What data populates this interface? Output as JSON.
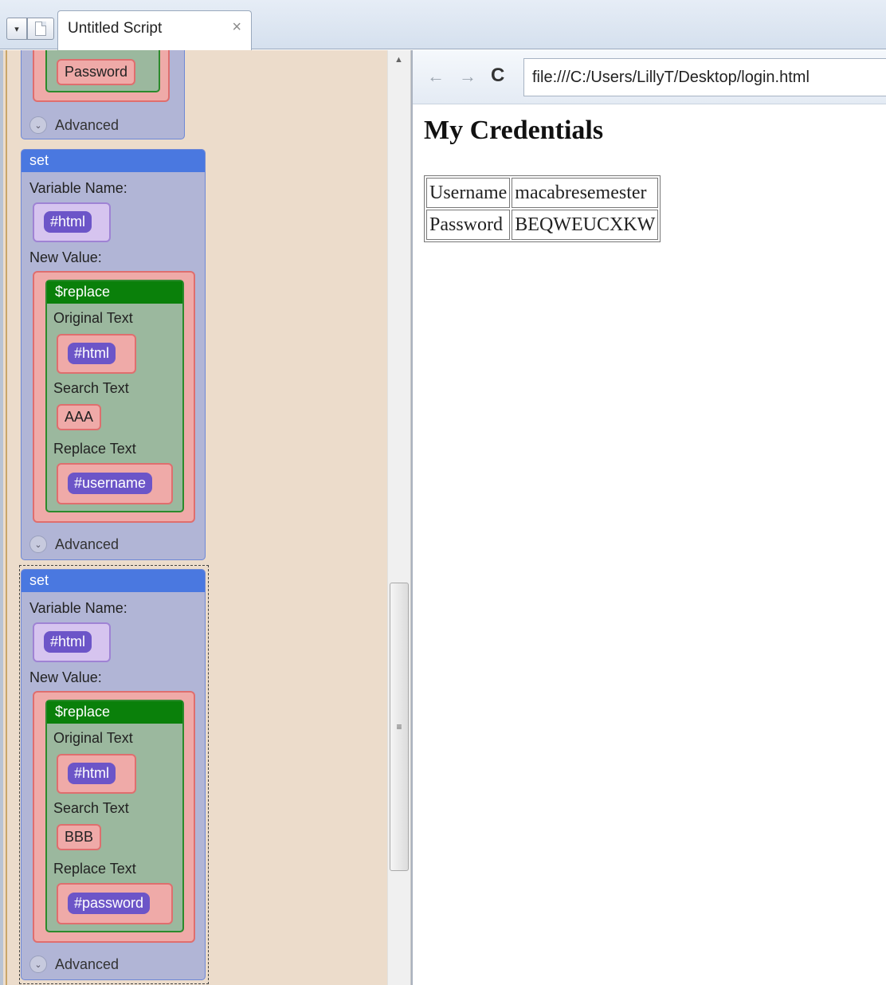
{
  "window": {
    "tab_title": "Untitled Script",
    "tab_close_glyph": "×",
    "menu_glyph": "▾"
  },
  "script_panel": {
    "top_fragment": {
      "chip": "Password",
      "advanced": "Advanced"
    },
    "set_blocks": [
      {
        "header": "set",
        "variable_label": "Variable Name:",
        "variable": "#html",
        "new_value_label": "New Value:",
        "replace": {
          "header": "$replace",
          "original_label": "Original Text",
          "original_var": "#html",
          "search_label": "Search Text",
          "search_value": "AAA",
          "replace_label": "Replace Text",
          "replace_var": "#username"
        },
        "advanced": "Advanced"
      },
      {
        "header": "set",
        "variable_label": "Variable Name:",
        "variable": "#html",
        "new_value_label": "New Value:",
        "replace": {
          "header": "$replace",
          "original_label": "Original Text",
          "original_var": "#html",
          "search_label": "Search Text",
          "search_value": "BBB",
          "replace_label": "Replace Text",
          "replace_var": "#password"
        },
        "advanced": "Advanced"
      }
    ]
  },
  "browser": {
    "url": "file:///C:/Users/LillyT/Desktop/login.html",
    "back_glyph": "←",
    "forward_glyph": "→",
    "reload_glyph": "C",
    "heading": "My Credentials",
    "table": [
      {
        "label": "Username",
        "value": "macabresemester"
      },
      {
        "label": "Password",
        "value": "BEQWEUCXKW"
      }
    ]
  },
  "colors": {
    "set_header": "#4a78e0",
    "replace_header": "#0a800a",
    "variable_pill": "#6c55c8",
    "panel_bg": "#ecdccb"
  }
}
